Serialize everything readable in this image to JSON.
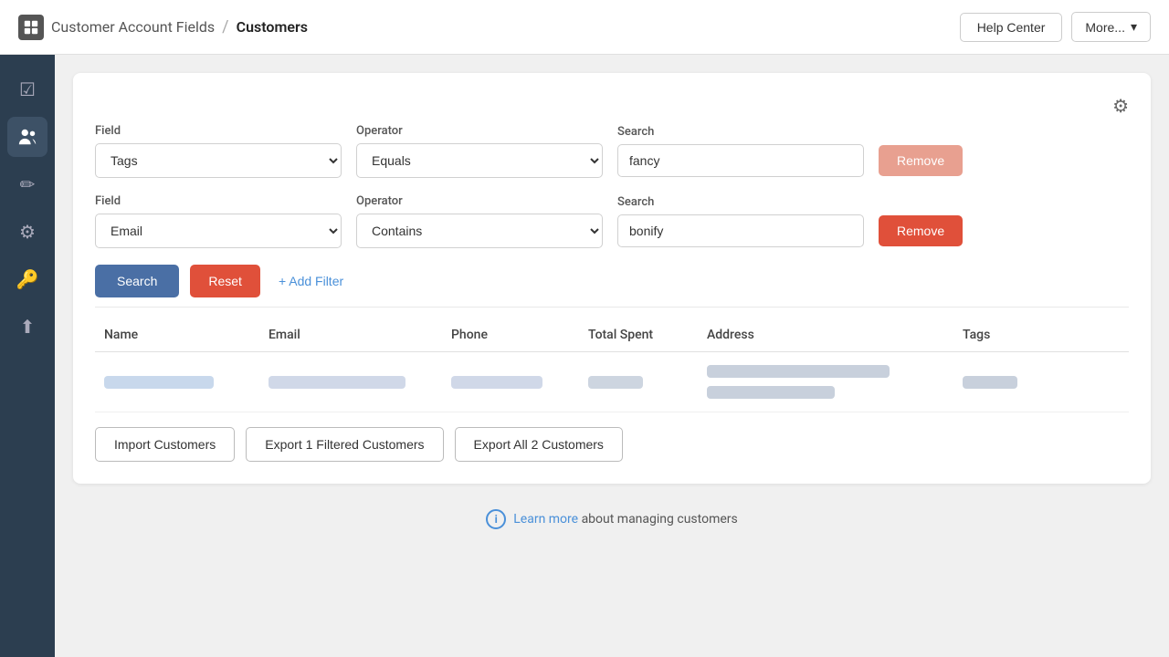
{
  "header": {
    "logo_label": "App Logo",
    "breadcrumb_main": "Customer Account Fields",
    "breadcrumb_sep": "/",
    "breadcrumb_current": "Customers",
    "help_label": "Help Center",
    "more_label": "More..."
  },
  "sidebar": {
    "items": [
      {
        "id": "checklist",
        "icon": "☑",
        "label": "checklist-icon"
      },
      {
        "id": "customers",
        "icon": "👥",
        "label": "customers-icon",
        "active": true
      },
      {
        "id": "edit",
        "icon": "✏",
        "label": "edit-icon"
      },
      {
        "id": "settings",
        "icon": "⚙",
        "label": "settings-icon"
      },
      {
        "id": "key",
        "icon": "🔑",
        "label": "key-icon"
      },
      {
        "id": "upload",
        "icon": "⬆",
        "label": "upload-icon"
      }
    ]
  },
  "filters": {
    "filter1": {
      "field_label": "Field",
      "field_value": "Tags",
      "operator_label": "Operator",
      "operator_value": "Equals",
      "search_label": "Search",
      "search_value": "fancy",
      "remove_label": "Remove"
    },
    "filter2": {
      "field_label": "Field",
      "field_value": "Email",
      "operator_label": "Operator",
      "operator_value": "Contains",
      "search_label": "Search",
      "search_value": "bonify",
      "remove_label": "Remove"
    }
  },
  "actions": {
    "search_label": "Search",
    "reset_label": "Reset",
    "add_filter_label": "+ Add Filter"
  },
  "table": {
    "columns": [
      "Name",
      "Email",
      "Phone",
      "Total Spent",
      "Address",
      "Tags"
    ]
  },
  "bottom_buttons": {
    "import_label": "Import Customers",
    "export_filtered_label": "Export 1 Filtered Customers",
    "export_all_label": "Export All 2 Customers"
  },
  "footer": {
    "learn_more_label": "Learn more",
    "footer_text": "about managing customers"
  },
  "gear_icon": "⚙",
  "chevron_down": "▾"
}
